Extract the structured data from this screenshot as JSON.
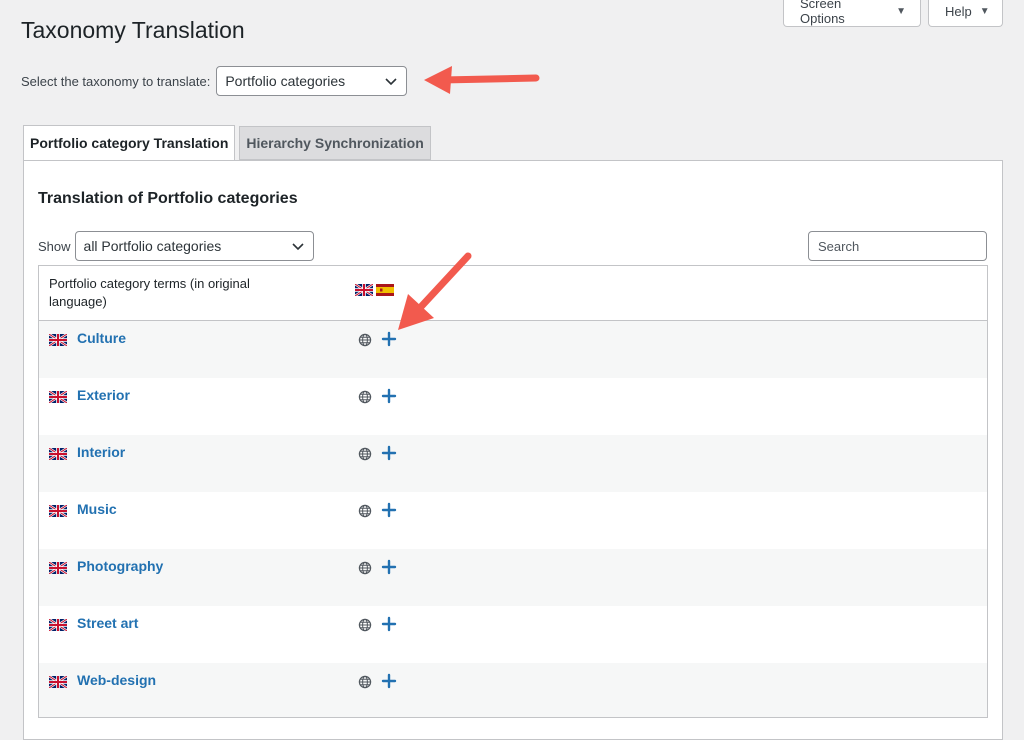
{
  "page": {
    "title": "Taxonomy Translation"
  },
  "screen_meta": {
    "screen_options": "Screen Options",
    "help": "Help"
  },
  "taxonomy_selector": {
    "label": "Select the taxonomy to translate:",
    "value": "Portfolio categories"
  },
  "tabs": [
    {
      "label": "Portfolio category Translation",
      "active": true
    },
    {
      "label": "Hierarchy Synchronization",
      "active": false
    }
  ],
  "panel": {
    "title": "Translation of Portfolio categories",
    "show_label": "Show",
    "show_value": "all Portfolio categories",
    "search_placeholder": "Search"
  },
  "table": {
    "column_header": "Portfolio category terms (in original language)",
    "languages": [
      "English",
      "Spanish"
    ],
    "rows": [
      {
        "term": "Culture"
      },
      {
        "term": "Exterior"
      },
      {
        "term": "Interior"
      },
      {
        "term": "Music"
      },
      {
        "term": "Photography"
      },
      {
        "term": "Street art"
      },
      {
        "term": "Web-design"
      }
    ]
  },
  "colors": {
    "link": "#2271b1",
    "annotation_arrow": "#f25a4e",
    "background": "#f0f0f1"
  },
  "icons": [
    "chevron-down-icon",
    "uk-flag-icon",
    "spain-flag-icon",
    "globe-icon",
    "plus-icon",
    "caret-down-icon"
  ]
}
